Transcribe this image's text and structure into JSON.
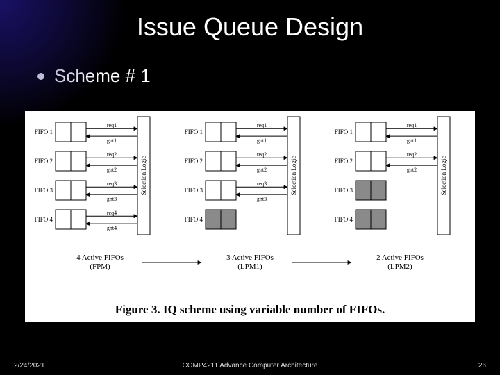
{
  "slide": {
    "title": "Issue Queue Design",
    "bullet": "Scheme # 1"
  },
  "figure": {
    "caption": "Figure 3. IQ scheme using variable number of FIFOs.",
    "sel_label": "Selection Logic",
    "blocks": {
      "a": {
        "subcaption": "4 Active FIFOs\n(FPM)",
        "fifos": [
          {
            "label": "FIFO 1",
            "shaded": false,
            "req": "req1",
            "gnt": "gnt1"
          },
          {
            "label": "FIFO 2",
            "shaded": false,
            "req": "req2",
            "gnt": "gnt2"
          },
          {
            "label": "FIFO 3",
            "shaded": false,
            "req": "req3",
            "gnt": "gnt3"
          },
          {
            "label": "FIFO 4",
            "shaded": false,
            "req": "req4",
            "gnt": "gnt4"
          }
        ]
      },
      "b": {
        "subcaption": "3 Active FIFOs\n(LPM1)",
        "fifos": [
          {
            "label": "FIFO 1",
            "shaded": false,
            "req": "req1",
            "gnt": "gnt1"
          },
          {
            "label": "FIFO 2",
            "shaded": false,
            "req": "req2",
            "gnt": "gnt2"
          },
          {
            "label": "FIFO 3",
            "shaded": false,
            "req": "req3",
            "gnt": "gnt3"
          },
          {
            "label": "FIFO 4",
            "shaded": true,
            "req": "",
            "gnt": ""
          }
        ]
      },
      "c": {
        "subcaption": "2 Active FIFOs\n(LPM2)",
        "fifos": [
          {
            "label": "FIFO 1",
            "shaded": false,
            "req": "req1",
            "gnt": "gnt1"
          },
          {
            "label": "FIFO 2",
            "shaded": false,
            "req": "req2",
            "gnt": "gnt2"
          },
          {
            "label": "FIFO 3",
            "shaded": true,
            "req": "",
            "gnt": ""
          },
          {
            "label": "FIFO 4",
            "shaded": true,
            "req": "",
            "gnt": ""
          }
        ]
      }
    }
  },
  "footer": {
    "date": "2/24/2021",
    "center": "COMP4211 Advance Computer Architecture",
    "page": "26"
  }
}
